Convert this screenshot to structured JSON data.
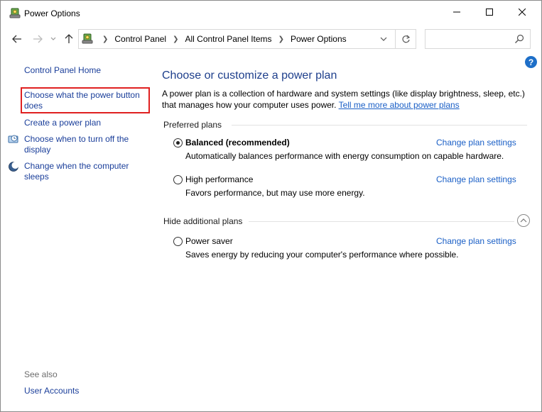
{
  "window": {
    "title": "Power Options",
    "controls": {
      "minimize_icon": "minimize-icon",
      "maximize_icon": "maximize-icon",
      "close_icon": "close-icon"
    }
  },
  "navigation": {
    "back_icon": "arrow-left-icon",
    "forward_icon": "arrow-right-icon",
    "recent_icon": "chevron-down-icon",
    "up_icon": "arrow-up-icon",
    "breadcrumbs": [
      "Control Panel",
      "All Control Panel Items",
      "Power Options"
    ],
    "search": {
      "value": "",
      "placeholder": ""
    }
  },
  "sidebar": {
    "home": "Control Panel Home",
    "links": {
      "power_button": "Choose what the power button does",
      "create_plan": "Create a power plan",
      "turn_off_display": "Choose when to turn off the display",
      "sleep": "Change when the computer sleeps"
    },
    "see_also": {
      "heading": "See also",
      "user_accounts": "User Accounts"
    }
  },
  "main": {
    "title": "Choose or customize a power plan",
    "description": "A power plan is a collection of hardware and system settings (like display brightness, sleep, etc.) that manages how your computer uses power.",
    "description_link": "Tell me more about power plans",
    "preferred_heading": "Preferred plans",
    "hidden_heading": "Hide additional plans",
    "plans": [
      {
        "name": "Balanced (recommended)",
        "description": "Automatically balances performance with energy consumption on capable hardware.",
        "selected": true,
        "action": "Change plan settings"
      },
      {
        "name": "High performance",
        "description": "Favors performance, but may use more energy.",
        "selected": false,
        "action": "Change plan settings"
      },
      {
        "name": "Power saver",
        "description": "Saves energy by reducing your computer's performance where possible.",
        "selected": false,
        "action": "Change plan settings"
      }
    ]
  },
  "colors": {
    "link": "#1a3e9a",
    "accent_link": "#1a5fc6",
    "title_blue": "#1e3f8c",
    "highlight_border": "#e02020"
  }
}
